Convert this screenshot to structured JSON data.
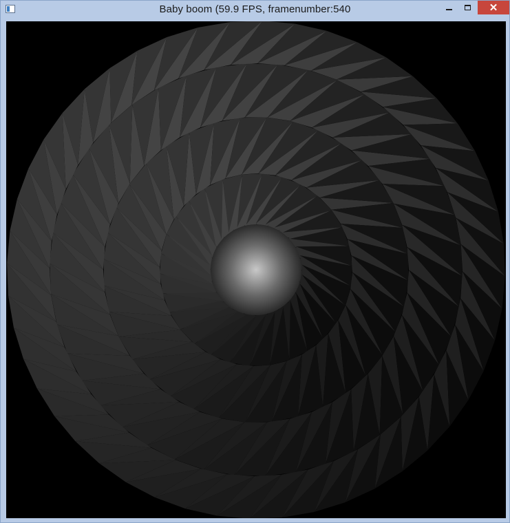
{
  "window": {
    "title": "Baby boom (59.9 FPS, framenumber:540",
    "icons": {
      "app": "app-window-icon",
      "minimize": "minimize-icon",
      "maximize": "maximize-icon",
      "close": "close-icon"
    },
    "close_glyph": "✕"
  },
  "scene": {
    "background": "#000000",
    "object": "shaded-spiral-disc",
    "ring_segment_counts": [
      24,
      30,
      36,
      42,
      48
    ],
    "colors": {
      "center_highlight": "#c8c8c8",
      "center_base": "#2a2a2a",
      "facet_light": "#3c3c3c",
      "facet_dark": "#151515"
    }
  }
}
